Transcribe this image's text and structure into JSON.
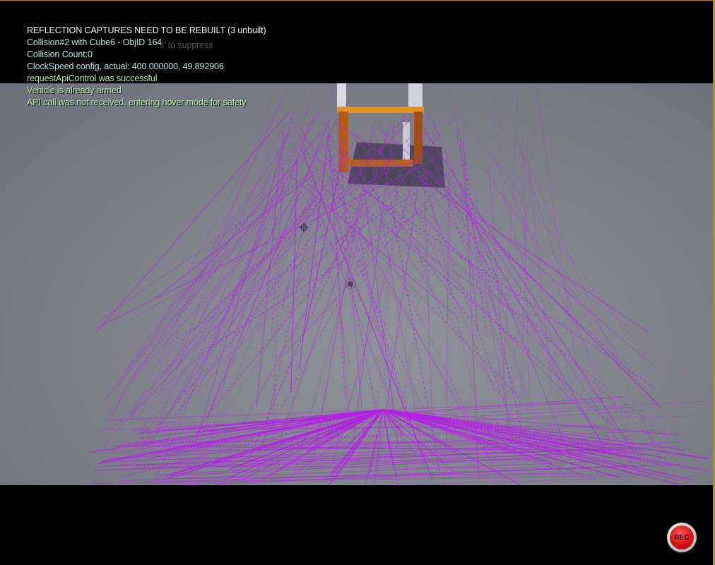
{
  "hud": {
    "messages": [
      "REFLECTION CAPTURES NEED TO BE REBUILT (3 unbuilt)",
      "Collision#2 with Cube6 - ObjID 164",
      "Collision Count:0",
      "ClockSpeed config, actual: 400.000000, 49.892906",
      "requestApiControl was successful",
      "Vehicle is already armed",
      "API call was not received, entering hover mode for safety"
    ],
    "ghost_text": "s' to suppress"
  },
  "scene": {
    "trajectory_color": "#b41ee6",
    "gate_color": "#e8901e",
    "floor_color": "#868992"
  },
  "recorder": {
    "label": "REC",
    "color": "#d21414"
  }
}
